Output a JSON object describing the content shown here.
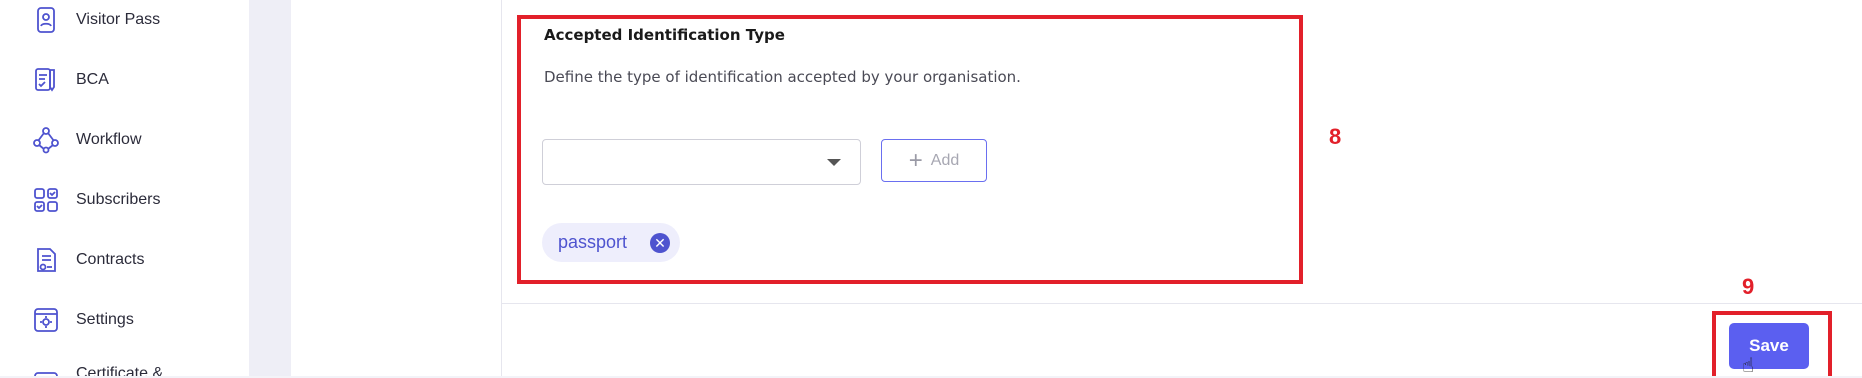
{
  "sidebar": {
    "items": [
      {
        "label": "Visitor Pass",
        "icon": "visitor-pass-icon"
      },
      {
        "label": "BCA",
        "icon": "bca-icon"
      },
      {
        "label": "Workflow",
        "icon": "workflow-icon"
      },
      {
        "label": "Subscribers",
        "icon": "subscribers-icon"
      },
      {
        "label": "Contracts",
        "icon": "contracts-icon"
      },
      {
        "label": "Settings",
        "icon": "settings-icon"
      },
      {
        "label": "Certificate &",
        "icon": "certificate-icon"
      }
    ]
  },
  "section": {
    "title": "Accepted Identification Type",
    "description": "Define the type of identification accepted by your organisation.",
    "select_value": "",
    "add_label": "Add",
    "chips": [
      {
        "label": "passport"
      }
    ]
  },
  "annotations": {
    "card": "8",
    "save": "9"
  },
  "footer": {
    "save_label": "Save"
  },
  "colors": {
    "accent": "#5b5ff0",
    "highlight": "#e2202a",
    "chip_bg": "#eeeefc"
  }
}
